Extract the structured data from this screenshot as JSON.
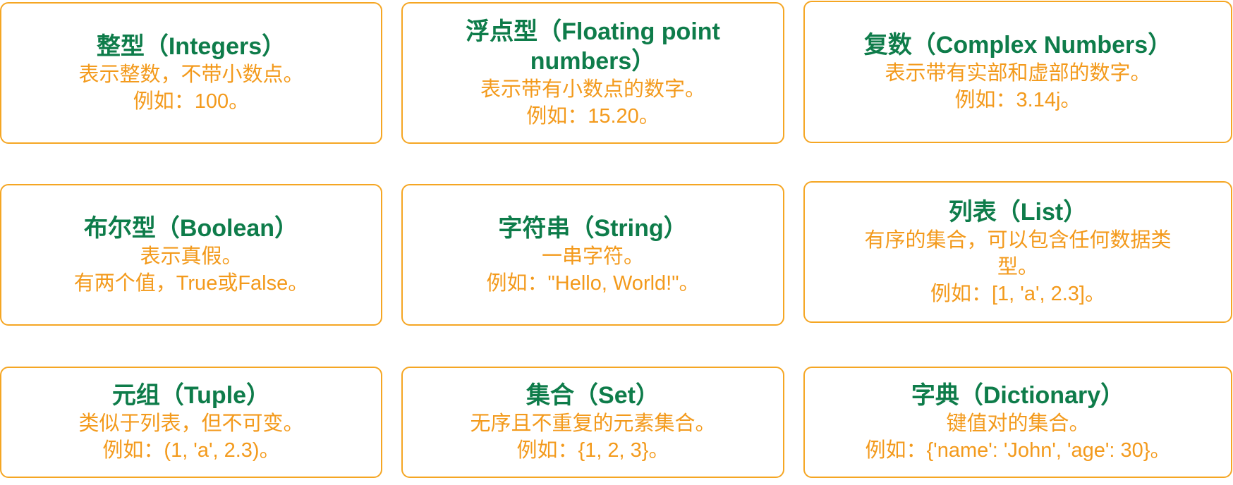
{
  "cards": [
    {
      "title": "整型（Integers）",
      "desc": "表示整数，不带小数点。",
      "example": "例如：100。"
    },
    {
      "title": "浮点型（Floating point numbers）",
      "desc": "表示带有小数点的数字。",
      "example": "例如：15.20。"
    },
    {
      "title": "复数（Complex Numbers）",
      "desc": "表示带有实部和虚部的数字。",
      "example": "例如：3.14j。"
    },
    {
      "title": "布尔型（Boolean）",
      "desc": "表示真假。",
      "example": "有两个值，True或False。"
    },
    {
      "title": "字符串（String）",
      "desc": "一串字符。",
      "example": "例如：\"Hello, World!\"。"
    },
    {
      "title": "列表（List）",
      "desc": "有序的集合，可以包含任何数据类型。",
      "example": "例如：[1, 'a', 2.3]。"
    },
    {
      "title": "元组（Tuple）",
      "desc": "类似于列表，但不可变。",
      "example": "例如：(1, 'a', 2.3)。"
    },
    {
      "title": "集合（Set）",
      "desc": "无序且不重复的元素集合。",
      "example": "例如：{1, 2, 3}。"
    },
    {
      "title": "字典（Dictionary）",
      "desc": "键值对的集合。",
      "example": "例如：{'name': 'John', 'age': 30}。"
    }
  ],
  "colors": {
    "border": "#F5A623",
    "title": "#0E7C4A",
    "text": "#F39A1C"
  }
}
